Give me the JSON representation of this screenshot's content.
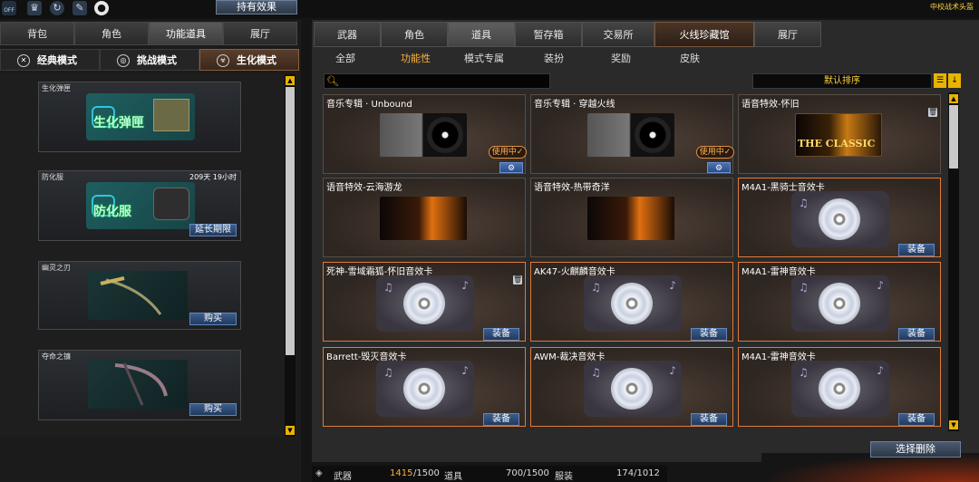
{
  "top": {
    "icons": [
      "off-toggle-icon",
      "trophy-icon",
      "refresh-icon",
      "pencil-icon",
      "penguin-icon"
    ],
    "off_label": "OFF",
    "hold_effect": "持有效果",
    "rank_title": "中校战术头盔"
  },
  "left": {
    "tabs": [
      "背包",
      "角色",
      "功能道具",
      "展厅"
    ],
    "modes": [
      "经典模式",
      "挑战模式",
      "生化模式"
    ],
    "items": [
      {
        "name": "生化弹匣",
        "title_text": "生化弹匣",
        "duration": "",
        "button": ""
      },
      {
        "name": "防化服",
        "title_text": "防化服",
        "duration": "209天 19小时",
        "button": "延长期限"
      },
      {
        "name": "幽灵之刃",
        "title_text": "",
        "duration": "",
        "button": "购买"
      },
      {
        "name": "夺命之镰",
        "title_text": "",
        "duration": "",
        "button": "购买"
      }
    ]
  },
  "right": {
    "tabs": [
      "武器",
      "角色",
      "道具",
      "暂存箱",
      "交易所",
      "火线珍藏馆",
      "展厅"
    ],
    "subtabs": [
      "全部",
      "功能性",
      "模式专属",
      "装扮",
      "奖励",
      "皮肤"
    ],
    "sort_label": "默认排序",
    "cards": [
      {
        "name": "音乐专辑 · Unbound",
        "status": "使用中✓"
      },
      {
        "name": "音乐专辑 · 穿越火线",
        "status": "使用中✓"
      },
      {
        "name": "语音特效-怀旧",
        "image_text": "THE CLASSIC"
      },
      {
        "name": "语音特效-云海游龙"
      },
      {
        "name": "语音特效-热带奇洋"
      },
      {
        "name": "M4A1-黑骑士音效卡",
        "button": "装备"
      },
      {
        "name": "死神-雪域霜狐-怀旧音效卡",
        "button": "装备"
      },
      {
        "name": "AK47-火麒麟音效卡",
        "button": "装备"
      },
      {
        "name": "M4A1-雷神音效卡",
        "button": "装备"
      },
      {
        "name": "Barrett-毁灭音效卡",
        "button": "装备"
      },
      {
        "name": "AWM-裁决音效卡",
        "button": "装备"
      },
      {
        "name": "M4A1-雷神音效卡",
        "button": "装备"
      }
    ],
    "delete_button": "选择删除"
  },
  "inventory": {
    "weapon_label": "武器",
    "weapon_count": "1415",
    "weapon_max": "/1500",
    "item_label": "道具",
    "item_count": "700/1500",
    "outfit_label": "服装",
    "outfit_count": "174/1012"
  },
  "colors": {
    "accent": "#ffb03a",
    "rank": "#ffd23a",
    "highlight_border": "#e07a3a"
  }
}
